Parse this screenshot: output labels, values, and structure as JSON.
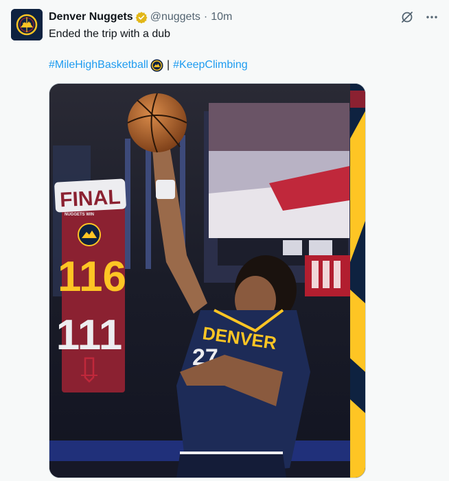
{
  "author": {
    "name": "Denver Nuggets",
    "handle": "@nuggets",
    "separator": "·",
    "time": "10m"
  },
  "tweet": {
    "text": "Ended the trip with a dub",
    "hashtag_1": "#MileHighBasketball",
    "separator": "|",
    "hashtag_2": "#KeepClimbing"
  },
  "graphic": {
    "final_label": "FINAL",
    "sub_label": "NUGGETS WIN",
    "nuggets_score": "116",
    "opponent_score": "111",
    "jersey_text": "DENVER",
    "jersey_number": "27"
  },
  "colors": {
    "accent": "#1d9bf0",
    "nuggets_navy": "#0e2240",
    "nuggets_gold": "#fec524",
    "nuggets_red": "#8b2131"
  },
  "icons": {
    "verified": "verified-badge-icon",
    "grok": "grok-icon",
    "more": "more-icon"
  }
}
